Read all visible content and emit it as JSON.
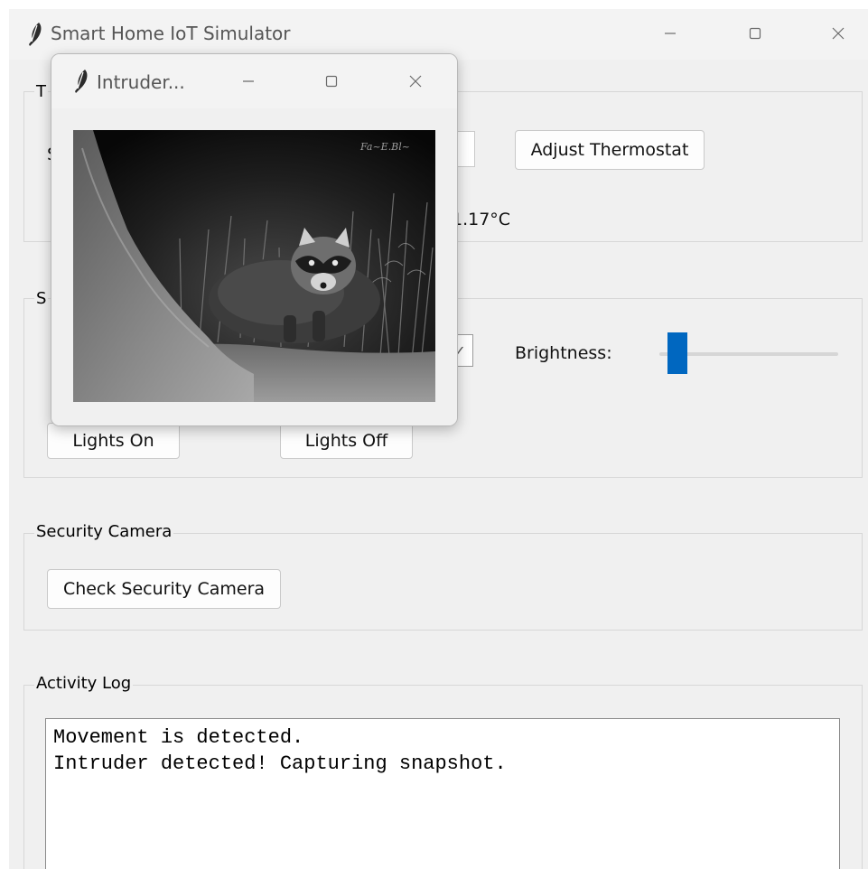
{
  "main_window": {
    "title": "Smart Home IoT Simulator",
    "controls": {
      "minimize": "—",
      "maximize": "☐",
      "close": "✕"
    }
  },
  "thermostat": {
    "group_label_visible": "T",
    "label_visible": "S",
    "adjust_button": "Adjust Thermostat",
    "temperature_visible": "1.17°C"
  },
  "smart_lights": {
    "group_label_visible": "S",
    "brightness_label": "Brightness:",
    "brightness_level": 0.05,
    "lights_on_button": "Lights On",
    "lights_off_button": "Lights Off",
    "check_mark": "✓"
  },
  "security_camera": {
    "group_label": "Security Camera",
    "check_button": "Check Security Camera"
  },
  "activity_log": {
    "group_label": "Activity Log",
    "lines": [
      "Movement is detected.",
      "Intruder detected! Capturing snapshot."
    ]
  },
  "popup": {
    "title": "Intruder...",
    "controls": {
      "minimize": "—",
      "maximize": "☐",
      "close": "✕"
    },
    "snapshot_subject": "raccoon-trail-camera-image"
  },
  "colors": {
    "accent": "#0067c0",
    "window_bg": "#f0f0f0"
  }
}
